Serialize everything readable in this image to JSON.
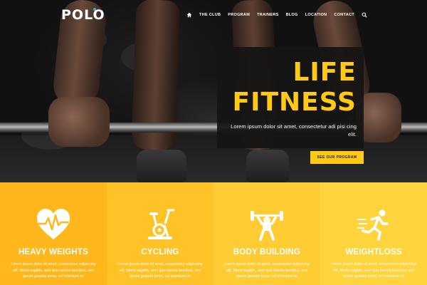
{
  "brand": {
    "logo": "POLO"
  },
  "nav": {
    "links": [
      {
        "id": "club",
        "label": "THE CLUB"
      },
      {
        "id": "program",
        "label": "PROGRAM"
      },
      {
        "id": "trainers",
        "label": "TRAINERS"
      },
      {
        "id": "blog",
        "label": "BLOG"
      },
      {
        "id": "location",
        "label": "LOCATION"
      },
      {
        "id": "contact",
        "label": "CONTACT"
      }
    ],
    "home_icon": "home-icon",
    "search_icon": "search-icon"
  },
  "hero": {
    "title_line1": "LIFE",
    "title_line2": "FITNESS",
    "subtitle": "Lorem ipsum dolor sit amet, consectetur adi pisi cing elit.",
    "cta_label": "SEE OUR PROGRAM"
  },
  "features": [
    {
      "title": "HEAVY WEIGHTS",
      "icon": "heart-rate-icon",
      "text": "Lorem ipsum dolor sit amet, consectetur adipiscing elit. Morbi sagittis, sem quis lacinia faucibus, orci ipsum gravida tortor, vel interdum mi",
      "bg": "#ffb71b"
    },
    {
      "title": "CYCLING",
      "icon": "exercise-bike-icon",
      "text": "Lorem ipsum dolor sit amet, consectetur adipiscing elit. Morbi sagittis, sem quis lacinia faucibus, orci ipsum gravida tortor, vel interdum mi",
      "bg": "#ffc328"
    },
    {
      "title": "BODY BUILDING",
      "icon": "weightlifter-icon",
      "text": "Lorem ipsum dolor sit amet, consectetur adipiscing elit. Morbi sagittis, sem quis lacinia faucibus, orci ipsum gravida tortor, vel interdum mi",
      "bg": "#ffcc33"
    },
    {
      "title": "WEIGHTLOSS",
      "icon": "runner-icon",
      "text": "Lorem ipsum dolor sit amet, consectetur adipiscing elit. Morbi sagittis, sem quis lacinia faucibus, orci ipsum gravida tortor, vel interdum mi",
      "bg": "#ffd43d"
    }
  ],
  "colors": {
    "accent": "#ffc916",
    "logo_dot": "#31b0d5",
    "card_bg": "#141414"
  }
}
